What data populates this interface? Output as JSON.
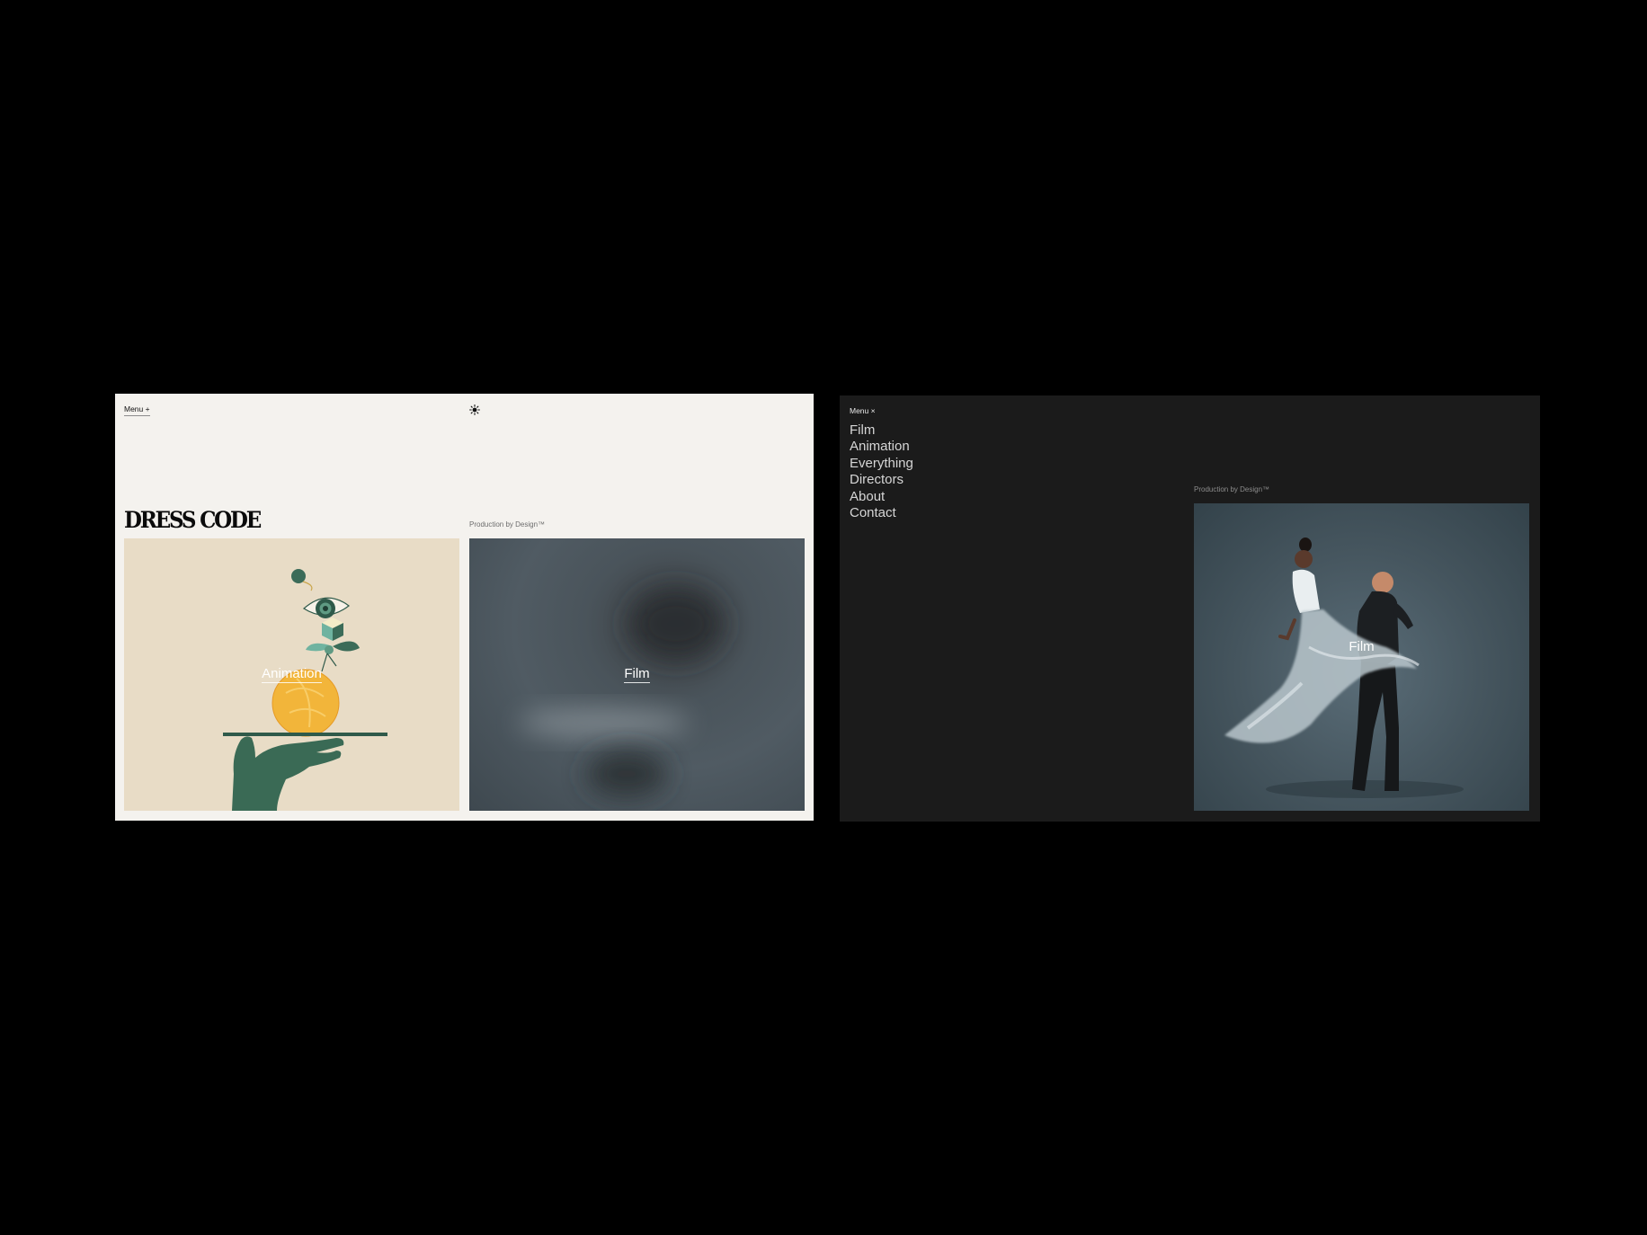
{
  "light": {
    "menu_label": "Menu +",
    "theme_icon": "sun-icon",
    "logo": "DRESS CODE",
    "tagline": "Production by Design™",
    "tiles": [
      {
        "label": "Animation"
      },
      {
        "label": "Film"
      }
    ]
  },
  "dark": {
    "menu_label": "Menu ×",
    "theme_icon": "moon-icon",
    "nav": [
      "Film",
      "Animation",
      "Everything",
      "Directors",
      "About",
      "Contact"
    ],
    "tagline": "Production by Design™",
    "tile_label": "Film"
  },
  "colors": {
    "light_bg": "#f4f2ee",
    "dark_bg": "#1b1b1b",
    "animation_tile": "#e8dcc6",
    "film_tile": "#4e5961",
    "accent_green": "#3b6b58",
    "accent_yellow": "#f2b53a"
  }
}
